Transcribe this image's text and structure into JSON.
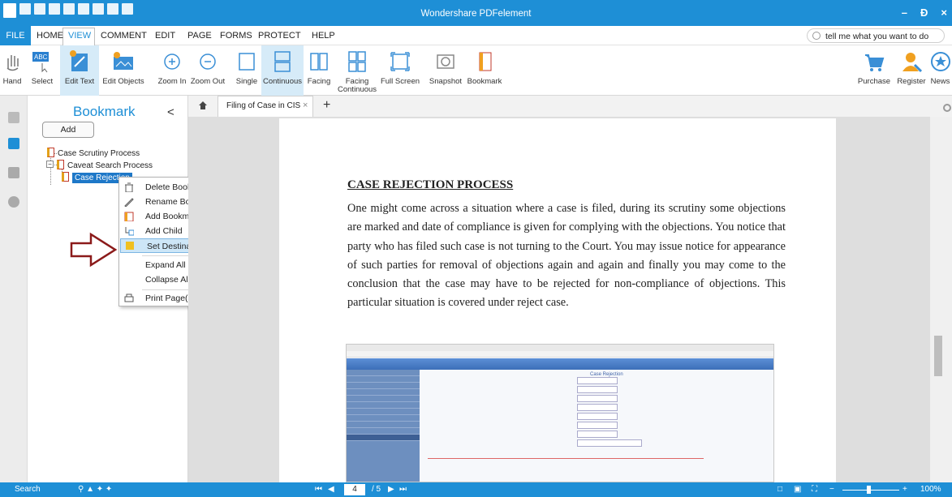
{
  "app": {
    "title": "Wondershare PDFelement",
    "window_controls": [
      "–",
      "Ɖ",
      "×"
    ]
  },
  "menu": {
    "file": "FILE",
    "tabs": [
      "HOME",
      "VIEW",
      "COMMENT",
      "EDIT",
      "PAGE",
      "FORMS",
      "PROTECT",
      "HELP"
    ],
    "active_tab": "VIEW",
    "tell_me_placeholder": "tell me what you want to do"
  },
  "ribbon": {
    "buttons": [
      "Hand",
      "Select",
      "Edit Text",
      "Edit Objects",
      "Zoom In",
      "Zoom Out",
      "Single",
      "Continuous",
      "Facing",
      "Facing Continuous",
      "Full Screen",
      "Snapshot",
      "Bookmark"
    ],
    "highlighted": [
      "Edit Text",
      "Continuous"
    ],
    "right_buttons": [
      "Purchase",
      "Register",
      "News"
    ]
  },
  "bookmark_panel": {
    "title": "Bookmark",
    "collapse_glyph": "<",
    "add_label": "Add",
    "items": [
      "Case Scrutiny Process",
      "Caveat Search Process",
      "Case Rejection"
    ],
    "selected": "Case Rejection"
  },
  "context_menu": {
    "items": [
      "Delete Bookmark(s)",
      "Rename Bookmark",
      "Add Bookmark",
      "Add Child",
      "Set Destination",
      "Expand All Bookmarks",
      "Collapse All Bookmarks",
      "Print Page(s)"
    ],
    "hovered": "Set Destination"
  },
  "doc_tab": {
    "label": "Filing of Case in CIS",
    "close": "×",
    "new_tab": "+"
  },
  "document": {
    "heading": "CASE REJECTION PROCESS",
    "paragraph": "One might come across a situation where a case is filed, during its scrutiny some objections are marked and date of compliance is given for complying with the objections. You notice that party who has filed such case is not turning to the Court. You may issue notice for appearance of such parties for removal of objections again and again and finally you may come to the conclusion that the case may have to be rejected for non-compliance of objections. This particular situation is covered under reject case.",
    "embedded_title": "Case Rejection"
  },
  "status_bar": {
    "search": "Search",
    "current_page": "4",
    "total_pages": "/ 5",
    "zoom": "100%"
  },
  "colors": {
    "accent": "#1e8fd6",
    "hover": "#cde6f7",
    "arrow": "#8b1a1a"
  }
}
